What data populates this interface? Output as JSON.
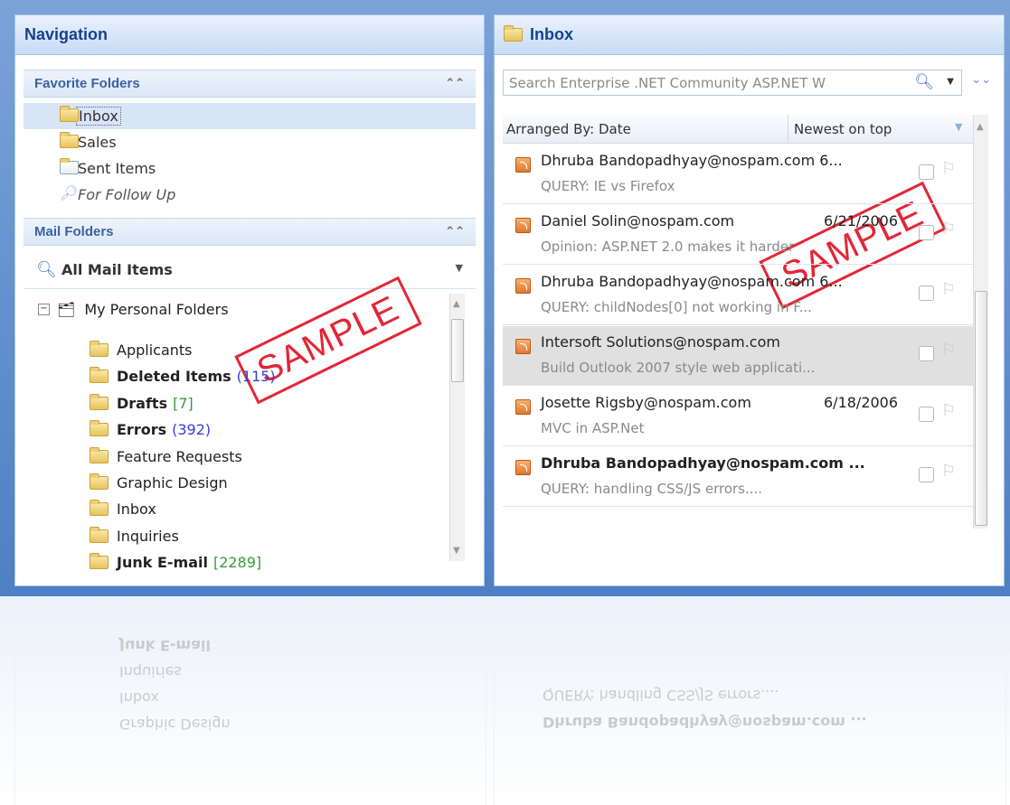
{
  "navigation": {
    "title": "Navigation",
    "favorites": {
      "title": "Favorite Folders",
      "items": [
        {
          "label": "Inbox",
          "icon": "inbox-folder-icon",
          "selected": true
        },
        {
          "label": "Sales",
          "icon": "folder-icon"
        },
        {
          "label": "Sent Items",
          "icon": "sent-items-icon"
        },
        {
          "label": "For Follow Up",
          "icon": "search-folder-icon",
          "italic": true
        }
      ]
    },
    "mail_folders": {
      "title": "Mail Folders",
      "all_items": "All Mail Items",
      "root": "My Personal Folders",
      "folders": [
        {
          "label": "Applicants",
          "count": "",
          "bold": false
        },
        {
          "label": "Deleted Items",
          "count": "(115)",
          "count_color": "#3340d9",
          "bold": true
        },
        {
          "label": "Drafts",
          "count": "[7]",
          "count_color": "#3a9a3a",
          "bold": true
        },
        {
          "label": "Errors",
          "count": "(392)",
          "count_color": "#3340d9",
          "bold": true
        },
        {
          "label": "Feature Requests",
          "count": "",
          "bold": false
        },
        {
          "label": "Graphic Design",
          "count": "",
          "bold": false
        },
        {
          "label": "Inbox",
          "count": "",
          "bold": false
        },
        {
          "label": "Inquiries",
          "count": "",
          "bold": false
        },
        {
          "label": "Junk E-mail",
          "count": "[2289]",
          "count_color": "#3a9a3a",
          "bold": true
        }
      ]
    }
  },
  "inbox": {
    "title": "Inbox",
    "search_placeholder": "Search Enterprise .NET Community  ASP.NET  W",
    "arranged_by": "Arranged By: Date",
    "sort_order": "Newest on top",
    "messages": [
      {
        "sender": "Dhruba Bandopadhyay@nospam.com 6...",
        "date": "",
        "subject": "QUERY: IE vs Firefox",
        "bold": false,
        "selected": false
      },
      {
        "sender": "Daniel Solin@nospam.com",
        "date": "6/21/2006",
        "subject": "Opinion: ASP.NET 2.0 makes it harder",
        "bold": false,
        "selected": false
      },
      {
        "sender": "Dhruba Bandopadhyay@nospam.com 6...",
        "date": "",
        "subject": "QUERY: childNodes[0] not working in F...",
        "bold": false,
        "selected": false
      },
      {
        "sender": "Intersoft Solutions@nospam.com",
        "date": "",
        "subject": "Build Outlook 2007 style web applicati...",
        "bold": false,
        "selected": true
      },
      {
        "sender": "Josette Rigsby@nospam.com",
        "date": "6/18/2006",
        "subject": "MVC in ASP.Net",
        "bold": false,
        "selected": false
      },
      {
        "sender": "Dhruba Bandopadhyay@nospam.com ...",
        "date": "",
        "subject": "QUERY: handling CSS/JS errors....",
        "bold": true,
        "selected": false
      }
    ]
  },
  "watermark": "SAMPLE",
  "colors": {
    "accent": "#15428b",
    "stamp": "#e32636",
    "frame": "#4f7fc4"
  }
}
